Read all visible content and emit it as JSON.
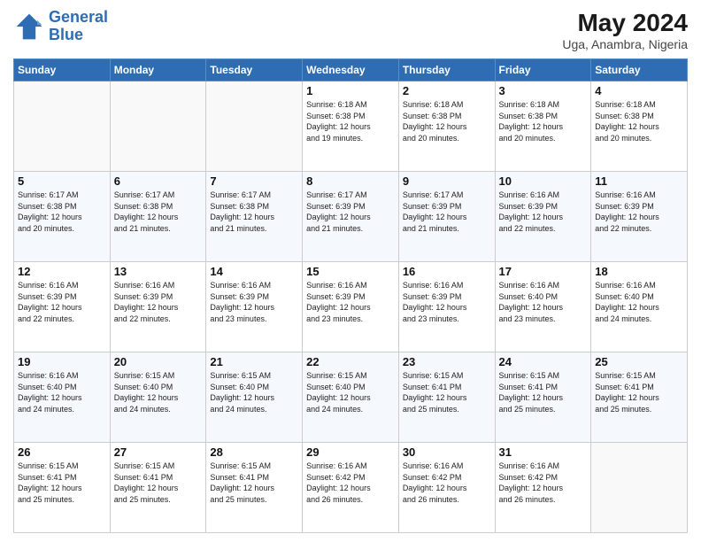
{
  "header": {
    "logo_line1": "General",
    "logo_line2": "Blue",
    "month_year": "May 2024",
    "location": "Uga, Anambra, Nigeria"
  },
  "days_of_week": [
    "Sunday",
    "Monday",
    "Tuesday",
    "Wednesday",
    "Thursday",
    "Friday",
    "Saturday"
  ],
  "weeks": [
    [
      {
        "day": "",
        "info": ""
      },
      {
        "day": "",
        "info": ""
      },
      {
        "day": "",
        "info": ""
      },
      {
        "day": "1",
        "info": "Sunrise: 6:18 AM\nSunset: 6:38 PM\nDaylight: 12 hours\nand 19 minutes."
      },
      {
        "day": "2",
        "info": "Sunrise: 6:18 AM\nSunset: 6:38 PM\nDaylight: 12 hours\nand 20 minutes."
      },
      {
        "day": "3",
        "info": "Sunrise: 6:18 AM\nSunset: 6:38 PM\nDaylight: 12 hours\nand 20 minutes."
      },
      {
        "day": "4",
        "info": "Sunrise: 6:18 AM\nSunset: 6:38 PM\nDaylight: 12 hours\nand 20 minutes."
      }
    ],
    [
      {
        "day": "5",
        "info": "Sunrise: 6:17 AM\nSunset: 6:38 PM\nDaylight: 12 hours\nand 20 minutes."
      },
      {
        "day": "6",
        "info": "Sunrise: 6:17 AM\nSunset: 6:38 PM\nDaylight: 12 hours\nand 21 minutes."
      },
      {
        "day": "7",
        "info": "Sunrise: 6:17 AM\nSunset: 6:38 PM\nDaylight: 12 hours\nand 21 minutes."
      },
      {
        "day": "8",
        "info": "Sunrise: 6:17 AM\nSunset: 6:39 PM\nDaylight: 12 hours\nand 21 minutes."
      },
      {
        "day": "9",
        "info": "Sunrise: 6:17 AM\nSunset: 6:39 PM\nDaylight: 12 hours\nand 21 minutes."
      },
      {
        "day": "10",
        "info": "Sunrise: 6:16 AM\nSunset: 6:39 PM\nDaylight: 12 hours\nand 22 minutes."
      },
      {
        "day": "11",
        "info": "Sunrise: 6:16 AM\nSunset: 6:39 PM\nDaylight: 12 hours\nand 22 minutes."
      }
    ],
    [
      {
        "day": "12",
        "info": "Sunrise: 6:16 AM\nSunset: 6:39 PM\nDaylight: 12 hours\nand 22 minutes."
      },
      {
        "day": "13",
        "info": "Sunrise: 6:16 AM\nSunset: 6:39 PM\nDaylight: 12 hours\nand 22 minutes."
      },
      {
        "day": "14",
        "info": "Sunrise: 6:16 AM\nSunset: 6:39 PM\nDaylight: 12 hours\nand 23 minutes."
      },
      {
        "day": "15",
        "info": "Sunrise: 6:16 AM\nSunset: 6:39 PM\nDaylight: 12 hours\nand 23 minutes."
      },
      {
        "day": "16",
        "info": "Sunrise: 6:16 AM\nSunset: 6:39 PM\nDaylight: 12 hours\nand 23 minutes."
      },
      {
        "day": "17",
        "info": "Sunrise: 6:16 AM\nSunset: 6:40 PM\nDaylight: 12 hours\nand 23 minutes."
      },
      {
        "day": "18",
        "info": "Sunrise: 6:16 AM\nSunset: 6:40 PM\nDaylight: 12 hours\nand 24 minutes."
      }
    ],
    [
      {
        "day": "19",
        "info": "Sunrise: 6:16 AM\nSunset: 6:40 PM\nDaylight: 12 hours\nand 24 minutes."
      },
      {
        "day": "20",
        "info": "Sunrise: 6:15 AM\nSunset: 6:40 PM\nDaylight: 12 hours\nand 24 minutes."
      },
      {
        "day": "21",
        "info": "Sunrise: 6:15 AM\nSunset: 6:40 PM\nDaylight: 12 hours\nand 24 minutes."
      },
      {
        "day": "22",
        "info": "Sunrise: 6:15 AM\nSunset: 6:40 PM\nDaylight: 12 hours\nand 24 minutes."
      },
      {
        "day": "23",
        "info": "Sunrise: 6:15 AM\nSunset: 6:41 PM\nDaylight: 12 hours\nand 25 minutes."
      },
      {
        "day": "24",
        "info": "Sunrise: 6:15 AM\nSunset: 6:41 PM\nDaylight: 12 hours\nand 25 minutes."
      },
      {
        "day": "25",
        "info": "Sunrise: 6:15 AM\nSunset: 6:41 PM\nDaylight: 12 hours\nand 25 minutes."
      }
    ],
    [
      {
        "day": "26",
        "info": "Sunrise: 6:15 AM\nSunset: 6:41 PM\nDaylight: 12 hours\nand 25 minutes."
      },
      {
        "day": "27",
        "info": "Sunrise: 6:15 AM\nSunset: 6:41 PM\nDaylight: 12 hours\nand 25 minutes."
      },
      {
        "day": "28",
        "info": "Sunrise: 6:15 AM\nSunset: 6:41 PM\nDaylight: 12 hours\nand 25 minutes."
      },
      {
        "day": "29",
        "info": "Sunrise: 6:16 AM\nSunset: 6:42 PM\nDaylight: 12 hours\nand 26 minutes."
      },
      {
        "day": "30",
        "info": "Sunrise: 6:16 AM\nSunset: 6:42 PM\nDaylight: 12 hours\nand 26 minutes."
      },
      {
        "day": "31",
        "info": "Sunrise: 6:16 AM\nSunset: 6:42 PM\nDaylight: 12 hours\nand 26 minutes."
      },
      {
        "day": "",
        "info": ""
      }
    ]
  ]
}
